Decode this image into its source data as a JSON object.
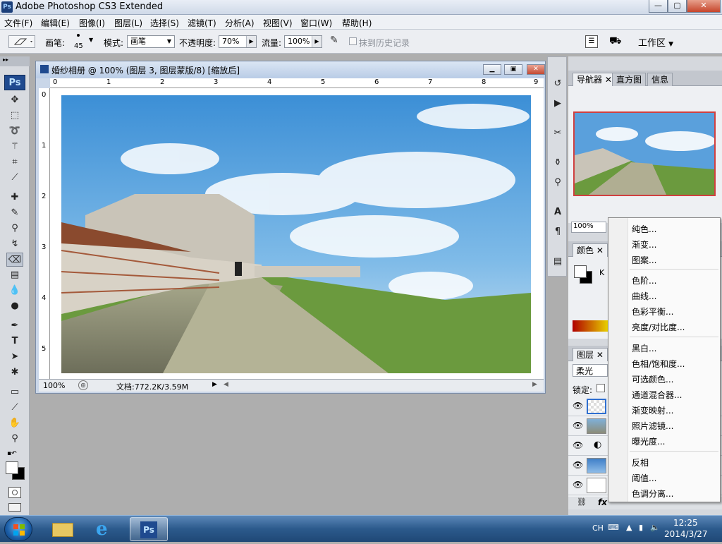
{
  "window": {
    "title": "Adobe Photoshop CS3 Extended",
    "ps_badge": "Ps",
    "buttons": {
      "minimize": "—",
      "maximize": "▢",
      "close": "✕"
    }
  },
  "menu": [
    "文件(F)",
    "编辑(E)",
    "图像(I)",
    "图层(L)",
    "选择(S)",
    "滤镜(T)",
    "分析(A)",
    "视图(V)",
    "窗口(W)",
    "帮助(H)"
  ],
  "options": {
    "brush_label": "画笔:",
    "brush_size": "45",
    "mode_label": "模式:",
    "mode_value": "画笔",
    "opacity_label": "不透明度:",
    "opacity_value": "70%",
    "flow_label": "流量:",
    "flow_value": "100%",
    "erase_history": "抹到历史记录",
    "workspace": "工作区"
  },
  "toolbox": {
    "logo": "Ps"
  },
  "document": {
    "title": "婚纱相册 @ 100% (图层 3, 图层蒙版/8) [缩放后]",
    "ruler_h": [
      "0",
      "1",
      "2",
      "3",
      "4",
      "5",
      "6",
      "7",
      "8",
      "9"
    ],
    "ruler_v": [
      "0",
      "1",
      "2",
      "3",
      "4",
      "5"
    ],
    "zoom": "100%",
    "doc_info": "文档:772.2K/3.59M"
  },
  "panels": {
    "top_tabs": [
      "导航器",
      "直方图",
      "信息"
    ],
    "nav_zoom": "100%",
    "color_tab": "颜色",
    "color_k": "K",
    "layers_tab": "图层",
    "blend_mode": "柔光",
    "lock_label": "锁定:",
    "fx_label": "fx"
  },
  "context_menu": {
    "groups": [
      [
        "纯色...",
        "渐变...",
        "图案..."
      ],
      [
        "色阶...",
        "曲线...",
        "色彩平衡...",
        "亮度/对比度..."
      ],
      [
        "黑白...",
        "色相/饱和度...",
        "可选颜色...",
        "通道混合器...",
        "渐变映射...",
        "照片滤镜...",
        "曝光度..."
      ],
      [
        "反相",
        "阈值...",
        "色调分离..."
      ]
    ]
  },
  "taskbar": {
    "ps_app_label": "Ps",
    "lang": "CH",
    "time": "12:25",
    "date": "2014/3/27"
  }
}
